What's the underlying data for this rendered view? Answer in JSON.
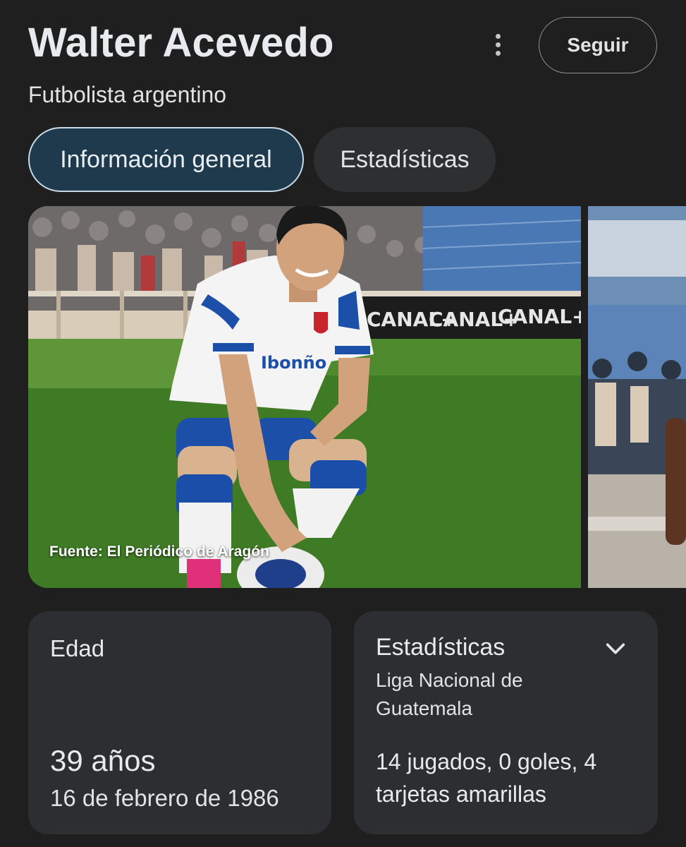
{
  "header": {
    "title": "Walter Acevedo",
    "subtitle": "Futbolista argentino",
    "more_icon": "more-vert-icon",
    "follow_label": "Seguir"
  },
  "tabs": [
    {
      "label": "Información general",
      "active": true
    },
    {
      "label": "Estadísticas",
      "active": false
    }
  ],
  "gallery": {
    "source": "Fuente: El Periódico de Aragón",
    "banner_text": "CANAL+",
    "shirt_text": "Ibonño"
  },
  "cards": {
    "age": {
      "label": "Edad",
      "value": "39 años",
      "date": "16 de febrero de 1986"
    },
    "stats": {
      "title": "Estadísticas",
      "league": "Liga Nacional de Guatemala",
      "summary": "14 jugados, 0 goles, 4 tarjetas amarillas",
      "expand_icon": "chevron-down-icon"
    }
  },
  "colors": {
    "background": "#1f1f1f",
    "active_tab": "#1e3a4c",
    "card": "#2c2e31"
  }
}
